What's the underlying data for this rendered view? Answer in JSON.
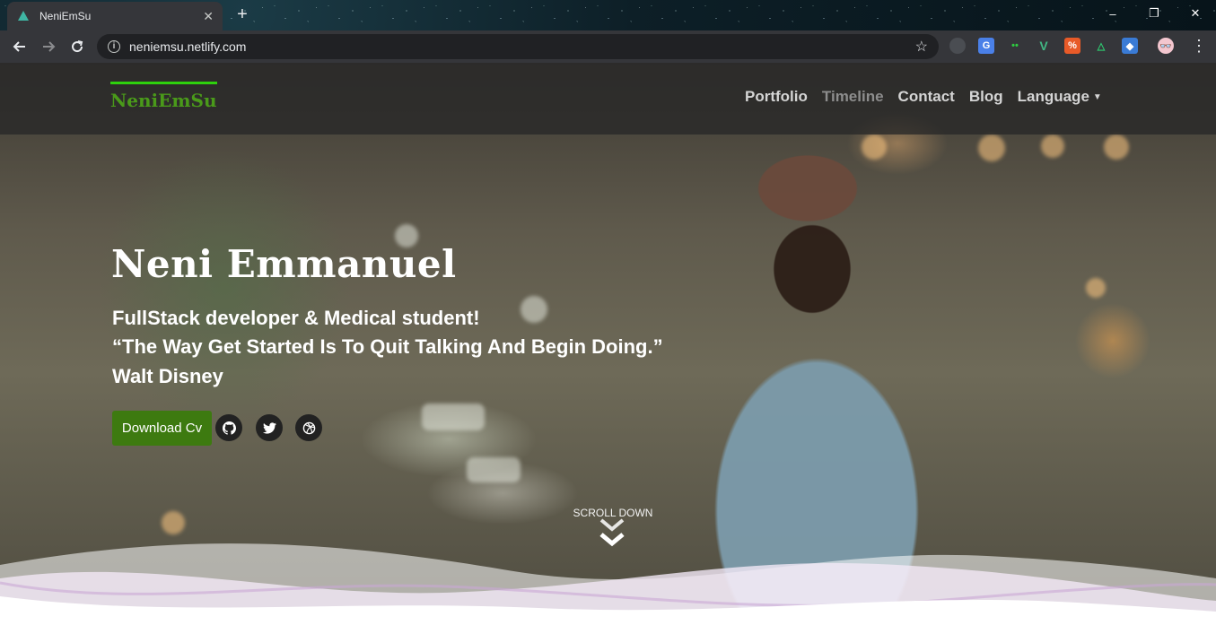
{
  "browser": {
    "tab": {
      "title": "NeniEmSu"
    },
    "url": "neniemsu.netlify.com",
    "window_controls": [
      "–",
      "❐",
      "✕"
    ]
  },
  "site": {
    "brand": "NeniEmSu",
    "nav": [
      {
        "label": "Portfolio"
      },
      {
        "label": "Timeline"
      },
      {
        "label": "Contact"
      },
      {
        "label": "Blog"
      },
      {
        "label": "Language"
      }
    ]
  },
  "hero": {
    "name": "Neni Emmanuel",
    "subtitle": "FullStack developer & Medical student!",
    "quote": "“The Way Get Started Is To Quit Talking And Begin Doing.”",
    "author": "Walt Disney",
    "download_label": "Download Cv",
    "social": [
      "github-icon",
      "twitter-icon",
      "dribbble-icon"
    ],
    "scroll_label": "SCROLL DOWN"
  },
  "colors": {
    "accent_green": "#3d7a10",
    "brand_green": "#4a9a1a",
    "brand_underline": "#2ed10d"
  }
}
